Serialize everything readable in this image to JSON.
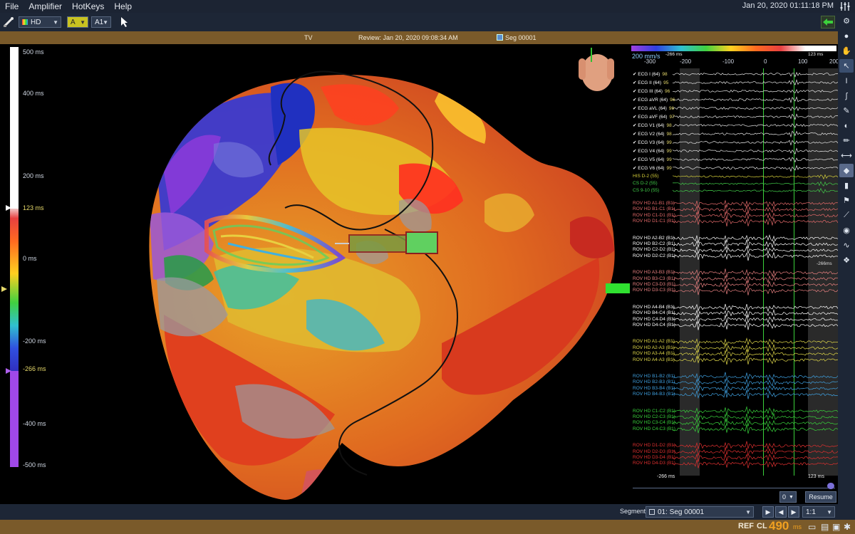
{
  "menu": {
    "items": [
      "File",
      "Amplifier",
      "HotKeys",
      "Help"
    ],
    "datetime": "Jan 20, 2020 01:11:18 PM"
  },
  "toolbar": {
    "map_select": "HD",
    "channel_select": "A",
    "sub_select": "A1"
  },
  "titlebar": {
    "map_name": "TV",
    "review": "Review: Jan 20, 2020 09:08:34 AM",
    "segment": "Seg 00001"
  },
  "color_scale": {
    "labels": [
      {
        "text": "500 ms",
        "color": "#cfd6e2"
      },
      {
        "text": "400 ms",
        "color": "#cfd6e2"
      },
      {
        "text": "200 ms",
        "color": "#cfd6e2"
      },
      {
        "text": "123 ms",
        "color": "#e6d96a"
      },
      {
        "text": "0 ms",
        "color": "#cfd6e2"
      },
      {
        "text": "-200 ms",
        "color": "#cfd6e2"
      },
      {
        "text": "-266 ms",
        "color": "#e6d96a"
      },
      {
        "text": "-400 ms",
        "color": "#cfd6e2"
      },
      {
        "text": "-500 ms",
        "color": "#cfd6e2"
      }
    ]
  },
  "waveforms": {
    "speed": "200 mm/s",
    "window_start": "-266 ms",
    "window_end": "123 ms",
    "axis_ticks": [
      "-300",
      "-200",
      "-100",
      "0",
      "100",
      "200"
    ],
    "marker_start": "-266 ms",
    "marker_end": "123 ms",
    "marker_value": "-266ms",
    "ecg": [
      {
        "label": "ECG I (64)",
        "val": "98"
      },
      {
        "label": "ECG II (64)",
        "val": "95"
      },
      {
        "label": "ECG III (64)",
        "val": "96"
      },
      {
        "label": "ECG aVR (64)",
        "val": "96"
      },
      {
        "label": "ECG aVL (64)",
        "val": "96"
      },
      {
        "label": "ECG aVF (64)",
        "val": "97"
      },
      {
        "label": "ECG V1 (64)",
        "val": "98"
      },
      {
        "label": "ECG V2 (64)",
        "val": "98"
      },
      {
        "label": "ECG V3 (64)",
        "val": "99"
      },
      {
        "label": "ECG V4 (64)",
        "val": "99"
      },
      {
        "label": "ECG V5 (64)",
        "val": "99"
      },
      {
        "label": "ECG V6 (64)",
        "val": "99"
      }
    ],
    "his": [
      {
        "label": "HIS D-2 (55)",
        "color": "#d8d23a"
      },
      {
        "label": "CS D-2 (55)",
        "color": "#42d04a"
      },
      {
        "label": "CS 9-10 (55)",
        "color": "#42d04a"
      }
    ],
    "groups": [
      {
        "color": "#e46a6a",
        "labels": [
          "ROV HD A1-B1 (B1)",
          "ROV HD B1-C1 (B1)",
          "ROV HD C1-D1 (B1)",
          "ROV HD D1-C1 (B1)"
        ]
      },
      {
        "color": "#ffffff",
        "labels": [
          "ROV HD A2-B2 (B1)",
          "ROV HD B2-C2 (B1)",
          "ROV HD C2-D2 (B1)",
          "ROV HD D2-C2 (B1)"
        ]
      },
      {
        "color": "#e88080",
        "labels": [
          "ROV HD A3-B3 (B1)",
          "ROV HD B3-C3 (B1)",
          "ROV HD C3-D3 (B1)",
          "ROV HD D3-C3 (B1)"
        ]
      },
      {
        "color": "#ffffff",
        "labels": [
          "ROV HD A4-B4 (B1)",
          "ROV HD B4-C4 (B1)",
          "ROV HD C4-D4 (B1)",
          "ROV HD D4-C4 (B1)"
        ]
      },
      {
        "color": "#e0d84a",
        "labels": [
          "ROV HD A1-A2 (B1)",
          "ROV HD A2-A3 (B1)",
          "ROV HD A3-A4 (B1)",
          "ROV HD A4-A3 (B1)"
        ]
      },
      {
        "color": "#3fa0e0",
        "labels": [
          "ROV HD B1-B2 (B1)",
          "ROV HD B2-B3 (B1)",
          "ROV HD B3-B4 (B1)",
          "ROV HD B4-B3 (B1)"
        ]
      },
      {
        "color": "#39d43c",
        "labels": [
          "ROV HD C1-C2 (B1)",
          "ROV HD C2-C3 (B1)",
          "ROV HD C3-C4 (B1)",
          "ROV HD C4-C3 (B1)"
        ]
      },
      {
        "color": "#e03030",
        "labels": [
          "ROV HD D1-D2 (B1)",
          "ROV HD D2-D3 (B1)",
          "ROV HD D3-D4 (B1)",
          "ROV HD D4-D3 (B1)"
        ]
      }
    ],
    "counter": "0",
    "resume": "Resume"
  },
  "segment_bar": {
    "label": "Segment",
    "value": "01: Seg 00001",
    "ratio": "1:1"
  },
  "status": {
    "ref": "REF",
    "cl": "CL",
    "cl_value": "490",
    "cl_unit": "ms"
  },
  "colors": {
    "menubar": "#1c2433",
    "accent_brown": "#7a5a2a",
    "highlight": "#f0a020"
  }
}
